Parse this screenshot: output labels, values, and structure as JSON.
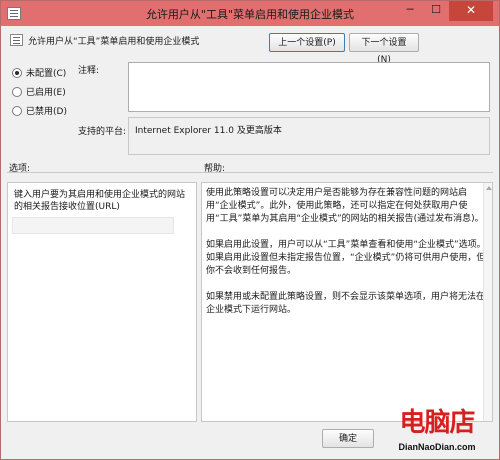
{
  "window": {
    "title": "允许用户从\"工具\"菜单启用和使用企业模式",
    "controls": {
      "minimize": "─",
      "maximize": "☐",
      "close": "✕"
    }
  },
  "header": {
    "policy_name": "允许用户从“工具”菜单启用和使用企业模式",
    "prev_label": "上一个设置(P)",
    "next_label": "下一个设置(N)"
  },
  "state": {
    "options": [
      {
        "label": "未配置(C)",
        "selected": true
      },
      {
        "label": "已启用(E)",
        "selected": false
      },
      {
        "label": "已禁用(D)",
        "selected": false
      }
    ]
  },
  "comment": {
    "label": "注释:",
    "value": ""
  },
  "platform": {
    "label": "支持的平台:",
    "value": "Internet Explorer 11.0 及更高版本"
  },
  "options_section": {
    "label": "选项:",
    "instruction": "键入用户要为其启用和使用企业模式的网站的相关报告接收位置(URL)",
    "url_value": ""
  },
  "help_section": {
    "label": "帮助:",
    "paragraphs": [
      "使用此策略设置可以决定用户是否能够为存在兼容性问题的网站启用“企业模式”。此外，使用此策略，还可以指定在何处获取用户使用“工具”菜单为其启用“企业模式”的网站的相关报告(通过发布消息)。",
      "如果启用此设置，用户可以从“工具”菜单查看和使用“企业模式”选项。如果启用此设置但未指定报告位置，“企业模式”仍将可供用户使用，但你不会收到任何报告。",
      "如果禁用或未配置此策略设置，则不会显示该菜单选项，用户将无法在企业模式下运行网站。"
    ]
  },
  "footer": {
    "ok_label": "确定"
  },
  "watermark": {
    "logo": "电脑店",
    "url": "DianNaoDian.com"
  },
  "colors": {
    "titlebar": "#e26f6f",
    "close_button": "#c7463c",
    "watermark_accent": "#d81f1f"
  }
}
